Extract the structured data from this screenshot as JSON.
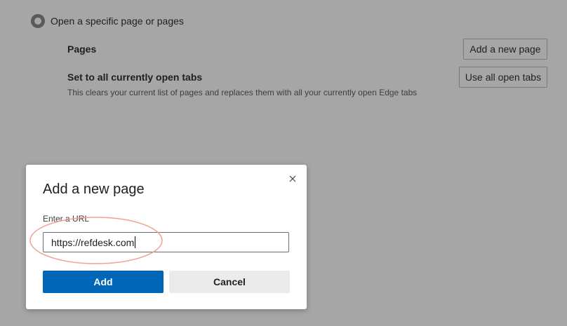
{
  "startup": {
    "option_label": "Open a specific page or pages",
    "pages_label": "Pages",
    "add_page_button": "Add a new page",
    "set_tabs_label": "Set to all currently open tabs",
    "set_tabs_description": "This clears your current list of pages and replaces them with all your currently open Edge tabs",
    "use_tabs_button": "Use all open tabs"
  },
  "dialog": {
    "title": "Add a new page",
    "close_icon": "close-icon",
    "url_label": "Enter a URL",
    "url_value": "https://refdesk.com",
    "add_button": "Add",
    "cancel_button": "Cancel"
  },
  "colors": {
    "overlay": "#a6a6a6",
    "primary": "#0067b8",
    "highlight": "#f0a290"
  }
}
